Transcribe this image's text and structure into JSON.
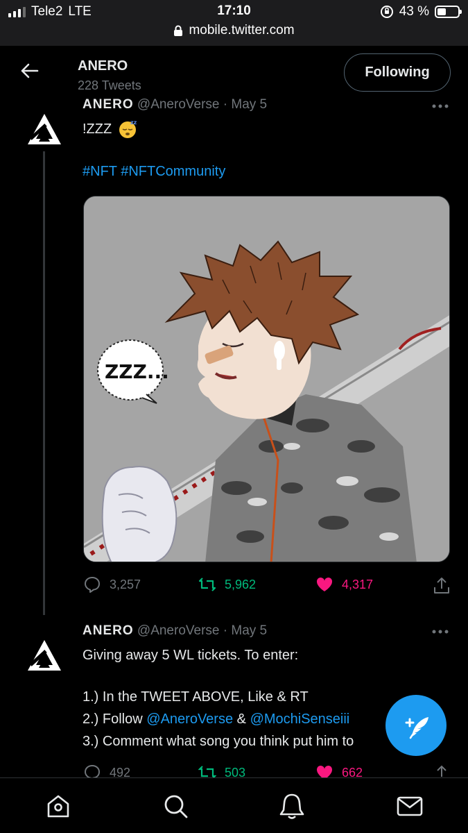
{
  "status_bar": {
    "carrier": "Tele2",
    "network": "LTE",
    "time": "17:10",
    "url": "mobile.twitter.com",
    "battery": "43 %",
    "battery_level": 0.43
  },
  "header": {
    "title": "ANERO",
    "subtitle": "228 Tweets",
    "follow_label": "Following"
  },
  "tweets": [
    {
      "name": "ANERO",
      "handle": "@AneroVerse",
      "date": "May 5",
      "text_line1": "!ZZZ",
      "hashtag1": "#NFT",
      "hashtag2": "#NFTCommunity",
      "replies": "3,257",
      "retweets": "5,962",
      "likes": "4,317",
      "image_text": "ZZZ..."
    },
    {
      "name": "ANERO",
      "handle": "@AneroVerse",
      "date": "May 5",
      "line1": "Giving away 5 WL tickets. To enter:",
      "line2": "1.) In the TWEET ABOVE, Like & RT",
      "line3_prefix": "2.) Follow",
      "mention1": "@AneroVerse",
      "amp": "&",
      "mention2": "@MochiSenseiii",
      "line4": "3.) Comment what song you think put him to",
      "replies": "492",
      "retweets": "503",
      "likes": "662"
    }
  ],
  "colors": {
    "accent": "#1d9bf0",
    "retweet": "#00ba7c",
    "like": "#f91880",
    "muted": "#71767b"
  },
  "nav": [
    "home-icon",
    "search-icon",
    "bell-icon",
    "mail-icon"
  ]
}
